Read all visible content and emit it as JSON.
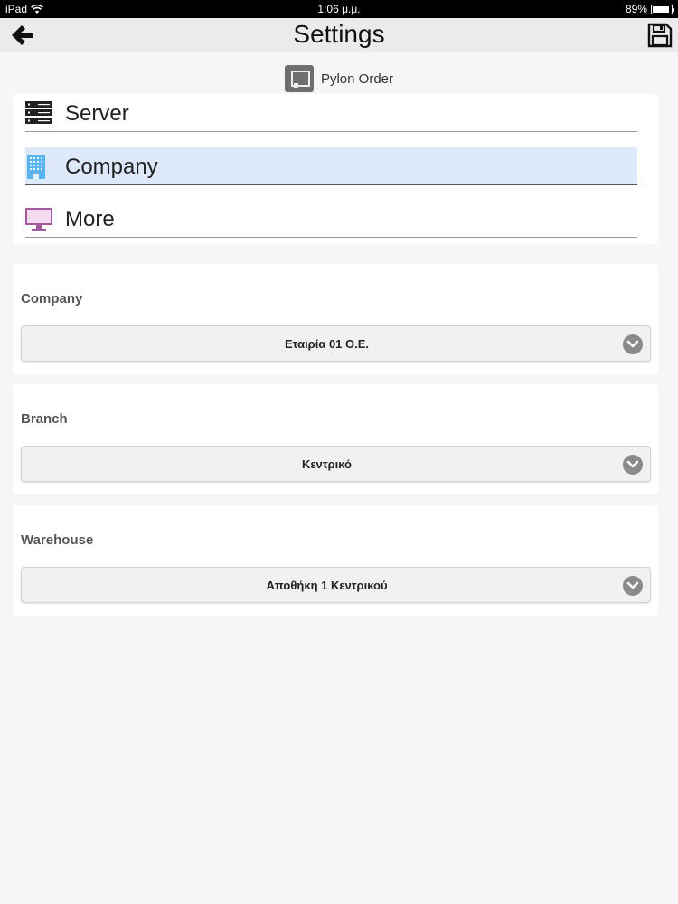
{
  "status_bar": {
    "device": "iPad",
    "time": "1:06 μ.μ.",
    "battery": "89%",
    "battery_level": 0.89
  },
  "nav": {
    "title": "Settings",
    "back_icon": "arrow-left-icon",
    "save_icon": "floppy-disk-icon"
  },
  "app": {
    "name": "Pylon Order",
    "icon": "app-logo-icon"
  },
  "menu": {
    "items": [
      {
        "label": "Server",
        "icon": "server-icon",
        "icon_color": "#222222",
        "active": false
      },
      {
        "label": "Company",
        "icon": "building-icon",
        "icon_color": "#5bb4ee",
        "active": true
      },
      {
        "label": "More",
        "icon": "monitor-icon",
        "icon_color": "#a55aa0",
        "active": false
      }
    ],
    "active_color": "#dde8fb"
  },
  "fields": {
    "company": {
      "label": "Company",
      "value": "Εταιρία 01 Ο.Ε."
    },
    "branch": {
      "label": "Branch",
      "value": "Κεντρικό"
    },
    "warehouse": {
      "label": "Warehouse",
      "value": "Αποθήκη 1 Κεντρικού"
    }
  },
  "colors": {
    "background": "#f6f6f8",
    "navbar": "#ebebed"
  }
}
